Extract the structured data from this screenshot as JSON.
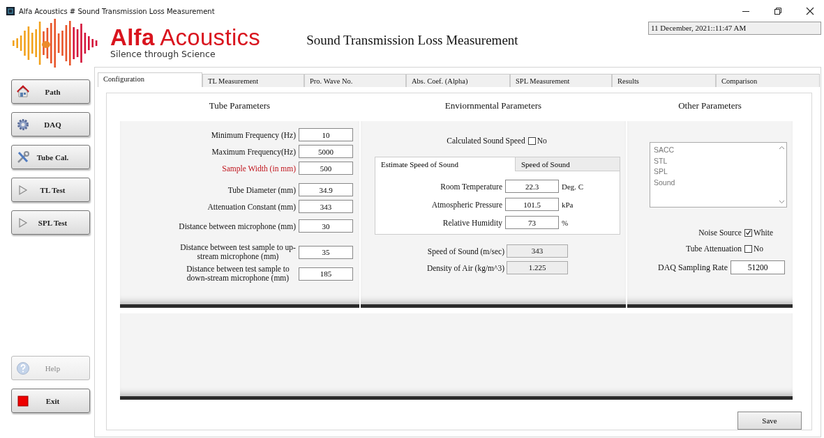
{
  "window": {
    "title": "Alfa Acoustics # Sound Transmission Loss Measurement"
  },
  "logo": {
    "name": "**Alfa** Acoustics",
    "tagline": "Silence through Science"
  },
  "app_title": "Sound Transmission Loss Measurement",
  "datetime": "11 December, 2021::11:47 AM",
  "sidebar": {
    "items": [
      {
        "label": "Path",
        "disabled": false
      },
      {
        "label": "DAQ",
        "disabled": false
      },
      {
        "label": "Tube Cal.",
        "disabled": false
      },
      {
        "label": "TL Test",
        "disabled": false
      },
      {
        "label": "SPL Test",
        "disabled": false
      },
      {
        "label": "Help",
        "disabled": true
      },
      {
        "label": "Exit",
        "disabled": false
      }
    ]
  },
  "tabs": [
    {
      "label": "Configuration",
      "selected": true
    },
    {
      "label": "TL Measurement",
      "selected": false
    },
    {
      "label": "Pro. Wave No.",
      "selected": false
    },
    {
      "label": "Abs. Coef. (Alpha)",
      "selected": false
    },
    {
      "label": "SPL Measurement",
      "selected": false
    },
    {
      "label": "Results",
      "selected": false
    },
    {
      "label": "Comparison",
      "selected": false
    }
  ],
  "tube_parameters": {
    "title": "Tube Parameters",
    "fields": [
      {
        "label": "Minimum Frequency (Hz)",
        "value": "10",
        "highlighted": false
      },
      {
        "label": "Maximum Frequency(Hz)",
        "value": "5000",
        "highlighted": false
      },
      {
        "label": "Sample Width (in mm)",
        "value": "500",
        "highlighted": true
      },
      {
        "label": "Tube Diameter (mm)",
        "value": "34.9",
        "highlighted": false
      },
      {
        "label": "Attenuation Constant (mm)",
        "value": "343",
        "highlighted": false
      },
      {
        "label": "Distance between microphone (mm)",
        "value": "30",
        "highlighted": false
      },
      {
        "label": "Distance between test sample to up-stream microphone (mm)",
        "value": "35",
        "highlighted": false
      },
      {
        "label": "Distance between test sample to down-stream microphone (mm)",
        "value": "185",
        "highlighted": false
      }
    ]
  },
  "environmental_parameters": {
    "title": "Enviornmental Parameters",
    "calculated_sound_speed": {
      "label": "Calculated Sound Speed",
      "checked": false,
      "option": "No"
    },
    "subtabs": [
      {
        "label": "Estimate Speed of Sound",
        "selected": true
      },
      {
        "label": "Speed of Sound",
        "selected": false
      }
    ],
    "fields": [
      {
        "label": "Room Temperature",
        "value": "22.3",
        "unit": "Deg. C"
      },
      {
        "label": "Atmospheric Pressure",
        "value": "101.5",
        "unit": "kPa"
      },
      {
        "label": "Relative Humidity",
        "value": "73",
        "unit": "%"
      }
    ],
    "outputs": [
      {
        "label": "Speed of Sound (m/sec)",
        "value": "343"
      },
      {
        "label": "Density of Air (kg/m^3)",
        "value": "1.225"
      }
    ]
  },
  "other_parameters": {
    "title": "Other Parameters",
    "list": [
      "SACC",
      "STL",
      "SPL",
      "Sound"
    ],
    "checkboxes": [
      {
        "label": "Noise Source",
        "checked": true,
        "option": "White"
      },
      {
        "label": "Tube Attenuation",
        "checked": false,
        "option": "No"
      }
    ],
    "sampling_rate": {
      "label": "DAQ Sampling Rate",
      "value": "51200"
    }
  },
  "save_button": "Save"
}
